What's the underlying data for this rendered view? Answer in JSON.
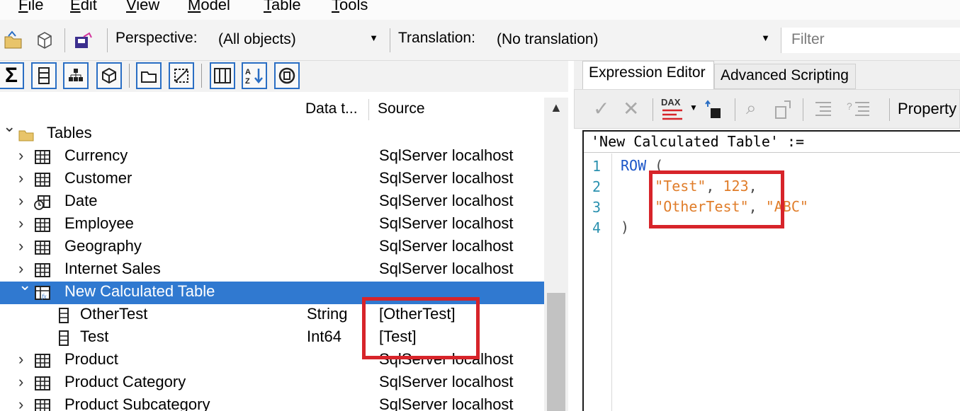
{
  "menu": {
    "items": [
      {
        "u": "F",
        "rest": "ile"
      },
      {
        "u": "E",
        "rest": "dit"
      },
      {
        "u": "V",
        "rest": "iew"
      },
      {
        "u": "M",
        "rest": "odel"
      },
      {
        "u": "T",
        "rest": "able"
      },
      {
        "u": "T",
        "rest": "ools"
      }
    ]
  },
  "toolbar": {
    "perspective_label": "Perspective:",
    "perspective_value": "(All objects)",
    "translation_label": "Translation:",
    "translation_value": "(No translation)",
    "filter_placeholder": "Filter"
  },
  "explorer": {
    "columns": {
      "datatype": "Data t...",
      "source": "Source"
    },
    "rows": [
      {
        "name": "Tables",
        "chevron": "⌄",
        "icon": "folder-icon",
        "dtype": "",
        "src": ""
      },
      {
        "name": "Currency",
        "chevron": "›",
        "icon": "table-icon",
        "dtype": "",
        "src": "SqlServer localhost"
      },
      {
        "name": "Customer",
        "chevron": "›",
        "icon": "table-icon",
        "dtype": "",
        "src": "SqlServer localhost"
      },
      {
        "name": "Date",
        "chevron": "›",
        "icon": "date-table-icon",
        "dtype": "",
        "src": "SqlServer localhost"
      },
      {
        "name": "Employee",
        "chevron": "›",
        "icon": "table-icon",
        "dtype": "",
        "src": "SqlServer localhost"
      },
      {
        "name": "Geography",
        "chevron": "›",
        "icon": "table-icon",
        "dtype": "",
        "src": "SqlServer localhost"
      },
      {
        "name": "Internet Sales",
        "chevron": "›",
        "icon": "table-icon",
        "dtype": "",
        "src": "SqlServer localhost"
      },
      {
        "name": "New Calculated Table",
        "chevron": "⌄",
        "icon": "calculated-table-icon",
        "dtype": "",
        "src": "",
        "selected": true
      },
      {
        "name": "OtherTest",
        "chevron": "",
        "icon": "column-icon",
        "dtype": "String",
        "src": "[OtherTest]"
      },
      {
        "name": "Test",
        "chevron": "",
        "icon": "column-icon",
        "dtype": "Int64",
        "src": "[Test]"
      },
      {
        "name": "Product",
        "chevron": "›",
        "icon": "table-icon",
        "dtype": "",
        "src": "SqlServer localhost"
      },
      {
        "name": "Product Category",
        "chevron": "›",
        "icon": "table-icon",
        "dtype": "",
        "src": "SqlServer localhost"
      },
      {
        "name": "Product Subcategory",
        "chevron": "›",
        "icon": "table-icon",
        "dtype": "",
        "src": "SqlServer localhost"
      }
    ]
  },
  "right": {
    "tabs": [
      "Expression Editor",
      "Advanced Scripting"
    ],
    "dax_label": "DAX",
    "property_label": "Property",
    "editor_title": "'New Calculated Table' :=",
    "line_numbers": [
      "1",
      "2",
      "3",
      "4"
    ],
    "code": {
      "l1_kw": "ROW",
      "l1_punc": " (",
      "l2_str": "\"Test\"",
      "l2_punc": ", ",
      "l2_num": "123",
      "l2_end": ",",
      "l3_str": "\"OtherTest\"",
      "l3_punc": ", ",
      "l3_str2": "\"ABC\"",
      "l4_punc": ")"
    }
  },
  "colors": {
    "selection": "#3079d0",
    "highlight_box": "#d7242a",
    "keyword": "#1a55c8",
    "string": "#e07d2a"
  }
}
